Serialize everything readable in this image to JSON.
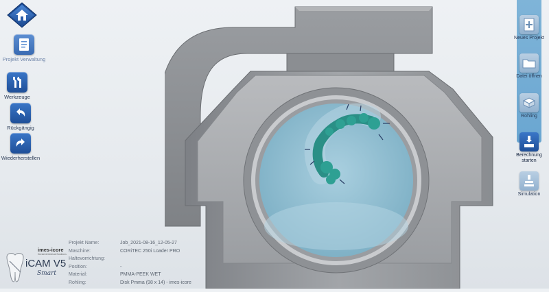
{
  "left_toolbar": {
    "items": [
      {
        "label": "Projekt Verwaltung",
        "icon": "document-icon",
        "enabled": false
      },
      {
        "label": "Werkzeuge",
        "icon": "tools-icon",
        "enabled": true
      },
      {
        "label": "Rückgängig",
        "icon": "undo-icon",
        "enabled": true
      },
      {
        "label": "Wiederherstellen",
        "icon": "redo-icon",
        "enabled": true
      }
    ]
  },
  "right_toolbar": {
    "items": [
      {
        "label": "Neues Projekt",
        "icon": "new-project-icon"
      },
      {
        "label": "Datei öffnen",
        "icon": "open-folder-icon"
      },
      {
        "label": "Rohling",
        "icon": "blank-icon"
      },
      {
        "label": "Berechnung starten",
        "icon": "calculate-icon"
      },
      {
        "label": "Simulation",
        "icon": "simulation-icon"
      }
    ]
  },
  "project_info": {
    "rows": [
      {
        "label": "Projekt Name:",
        "value": "Job_2021-08-16_12-05-27"
      },
      {
        "label": "Maschine:",
        "value": "CORiTEC 250i Loader PRO"
      },
      {
        "label": "Haltevorrichtung:",
        "value": ""
      },
      {
        "label": "Position:",
        "value": "-"
      },
      {
        "label": "Material:",
        "value": "PMMA-PEEK WET"
      },
      {
        "label": "Rohling:",
        "value": "Disk Pmma (98 x 14) - imes-icore"
      }
    ]
  },
  "branding": {
    "company": "imes-icore",
    "company_tagline": "Dental & Medical Solutions",
    "product": "iCAM V5",
    "edition": "Smart"
  },
  "colors": {
    "accent": "#1f4f98",
    "clamp_gray": "#8a8d91",
    "disc_blue": "#9ec4d6",
    "model_green": "#2a8f86"
  }
}
